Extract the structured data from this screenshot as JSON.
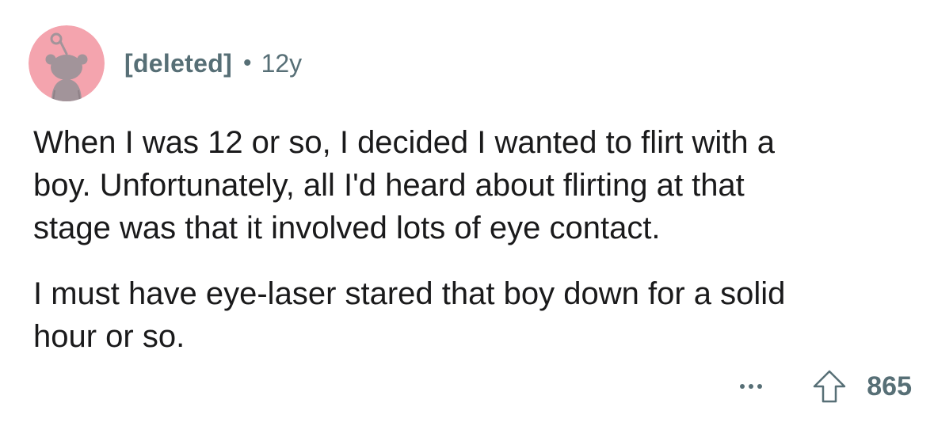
{
  "comment": {
    "author": "[deleted]",
    "separator": "•",
    "age": "12y",
    "paragraphs": [
      "When I was 12 or so, I decided I wanted to flirt with a\nboy. Unfortunately, all I'd heard about flirting at that\nstage was that it involved lots of eye contact.",
      "I must have eye-laser stared that boy down for a solid\nhour or so."
    ],
    "score": "865"
  },
  "icons": {
    "avatar": "snoo-avatar-icon",
    "more": "more-options-icon",
    "upvote": "upvote-arrow-icon"
  },
  "colors": {
    "avatar_background": "#f4a4ae",
    "avatar_figure": "#a2949a",
    "meta_text": "#576f76",
    "body_text": "#1a1a1b"
  }
}
